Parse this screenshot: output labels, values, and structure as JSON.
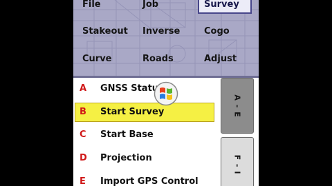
{
  "menu": {
    "items": [
      {
        "label": "File"
      },
      {
        "label": "Job"
      },
      {
        "label": "Survey",
        "selected": true
      },
      {
        "label": "Stakeout"
      },
      {
        "label": "Inverse"
      },
      {
        "label": "Cogo"
      },
      {
        "label": "Curve"
      },
      {
        "label": "Roads"
      },
      {
        "label": "Adjust"
      }
    ]
  },
  "list": {
    "items": [
      {
        "letter": "A",
        "label": "GNSS Statu"
      },
      {
        "letter": "B",
        "label": "Start Survey",
        "selected": true
      },
      {
        "letter": "C",
        "label": "Start Base"
      },
      {
        "letter": "D",
        "label": "Projection"
      },
      {
        "letter": "E",
        "label": "Import GPS Control"
      }
    ]
  },
  "tabs": [
    {
      "label": "A - E",
      "active": true
    },
    {
      "label": "F - I",
      "active": false
    }
  ],
  "icons": {
    "start_menu": "windows-flag-icon"
  },
  "colors": {
    "menu_background": "#a9a8c6",
    "selected_row": "#f5f044",
    "letter_red": "#d01818",
    "active_tab": "#8c8c8c"
  }
}
